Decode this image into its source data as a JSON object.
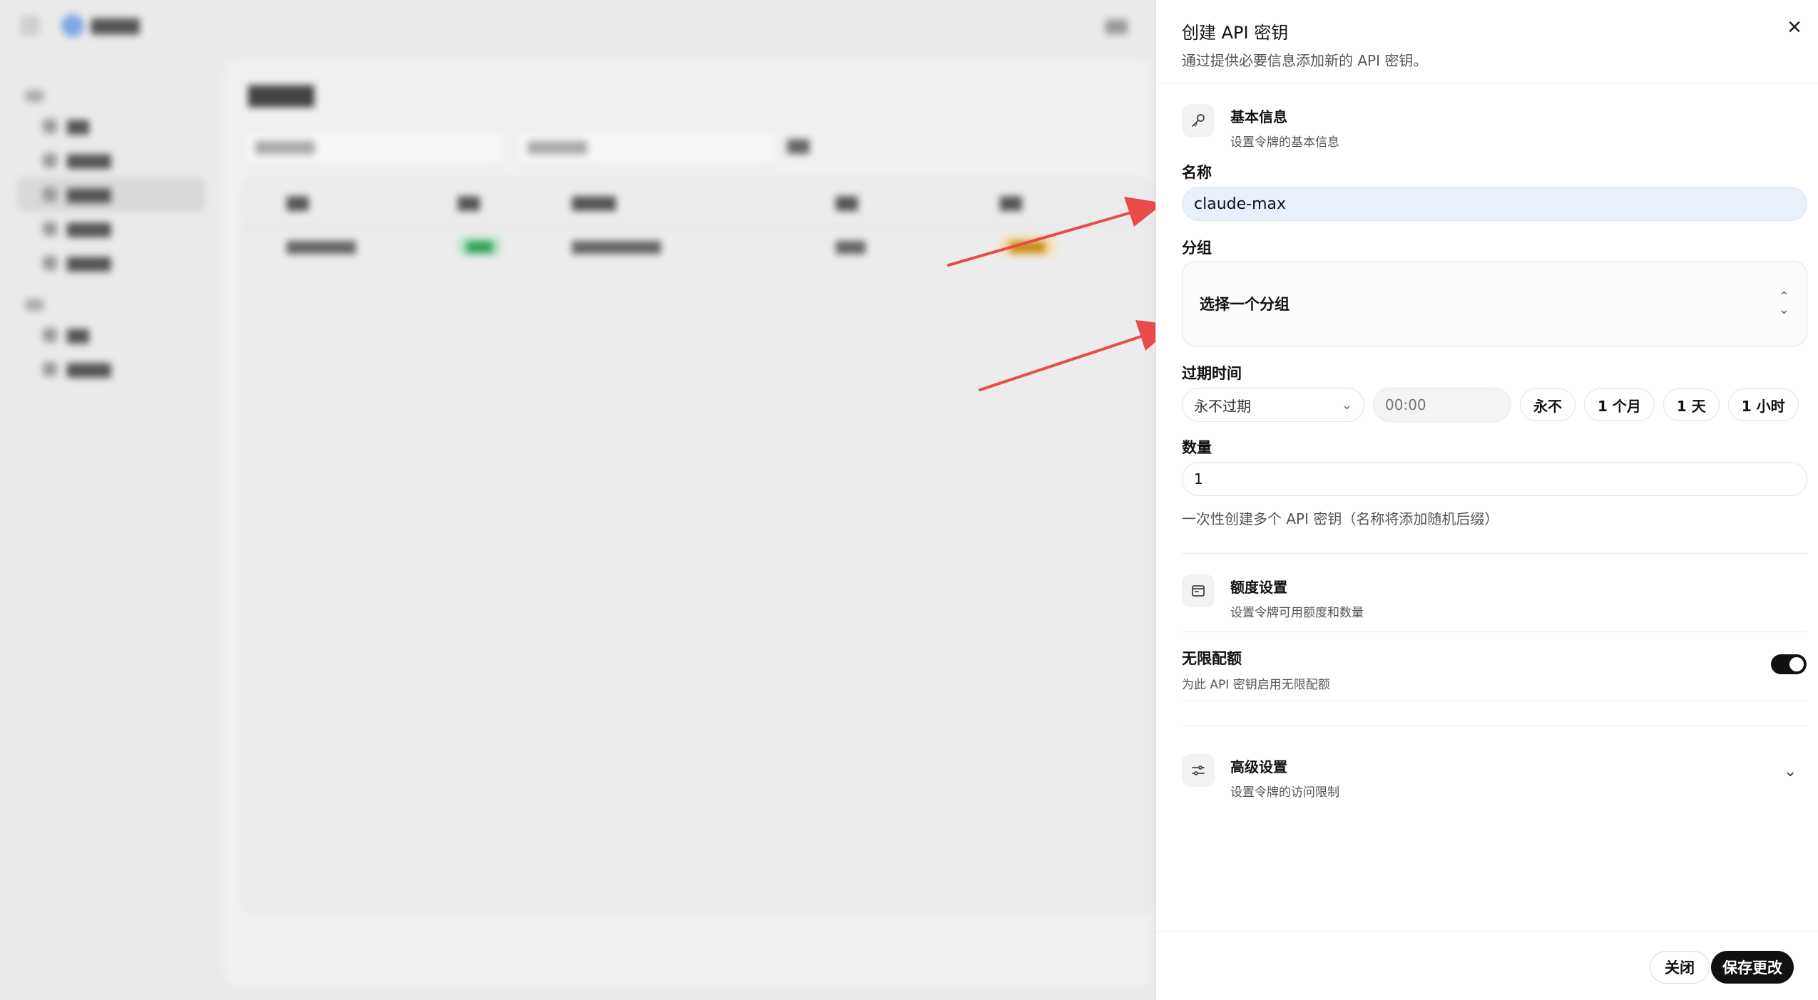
{
  "drawer": {
    "title": "创建 API 密钥",
    "description": "通过提供必要信息添加新的 API 密钥。",
    "basic": {
      "title": "基本信息",
      "subtitle": "设置令牌的基本信息",
      "icon": "key-icon"
    },
    "name_label": "名称",
    "name_value": "claude-max",
    "group_label": "分组",
    "group_placeholder": "选择一个分组",
    "expire_label": "过期时间",
    "expire_select_value": "永不过期",
    "expire_time_placeholder": "00:00",
    "expire_presets": [
      "永不",
      "1 个月",
      "1 天",
      "1 小时"
    ],
    "quantity_label": "数量",
    "quantity_value": "1",
    "quantity_help": "一次性创建多个 API 密钥（名称将添加随机后缀）",
    "quota": {
      "title": "额度设置",
      "subtitle": "设置令牌可用额度和数量",
      "icon": "wallet-icon"
    },
    "unlimited": {
      "title": "无限配额",
      "subtitle": "为此 API 密钥启用无限配额",
      "enabled": true
    },
    "advanced": {
      "title": "高级设置",
      "subtitle": "设置令牌的访问限制",
      "icon": "sliders-icon"
    },
    "close_button": "关闭",
    "save_button": "保存更改"
  },
  "colors": {
    "accent": "#111111",
    "arrow": "#e94a4a",
    "name_input_bg": "#e8f0fc"
  }
}
